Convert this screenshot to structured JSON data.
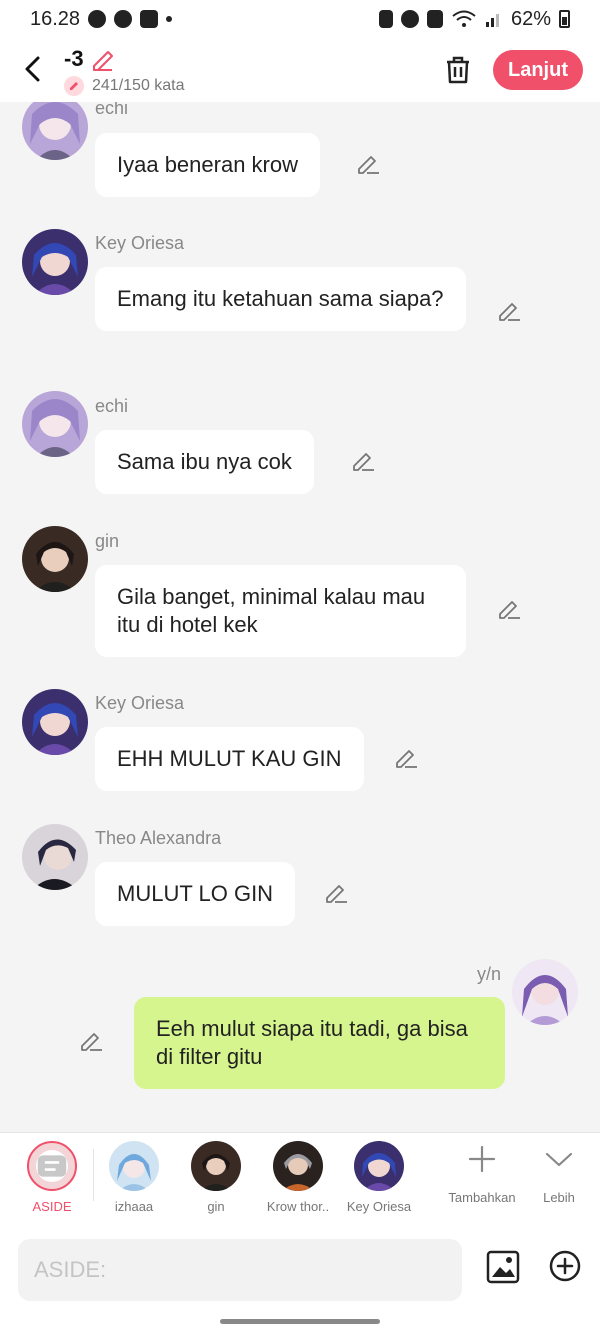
{
  "status_bar": {
    "time": "16.28",
    "battery": "62%"
  },
  "header": {
    "title": "-3",
    "word_count": "241/150 kata",
    "next_label": "Lanjut",
    "accent": "#f0506a"
  },
  "messages": [
    {
      "sender": "echi",
      "text": "Iyaa beneran krow"
    },
    {
      "sender": "Key Oriesa",
      "text": "Emang itu ketahuan sama siapa?"
    },
    {
      "sender": "echi",
      "text": "Sama ibu nya cok"
    },
    {
      "sender": "gin",
      "text": "Gila banget, minimal kalau mau itu di hotel kek"
    },
    {
      "sender": "Key Oriesa",
      "text": "EHH MULUT KAU GIN"
    },
    {
      "sender": "Theo Alexandra",
      "text": "MULUT LO GIN"
    },
    {
      "sender": "y/n",
      "text": "Eeh mulut siapa itu tadi, ga bisa di filter gitu",
      "mine": true,
      "bubble_color": "#d7f58f"
    }
  ],
  "characters": {
    "aside": "ASIDE",
    "items": [
      "izhaaa",
      "gin",
      "Krow thor..",
      "Key Oriesa"
    ],
    "add_label": "Tambahkan",
    "more_label": "Lebih"
  },
  "input": {
    "placeholder": "ASIDE:"
  }
}
